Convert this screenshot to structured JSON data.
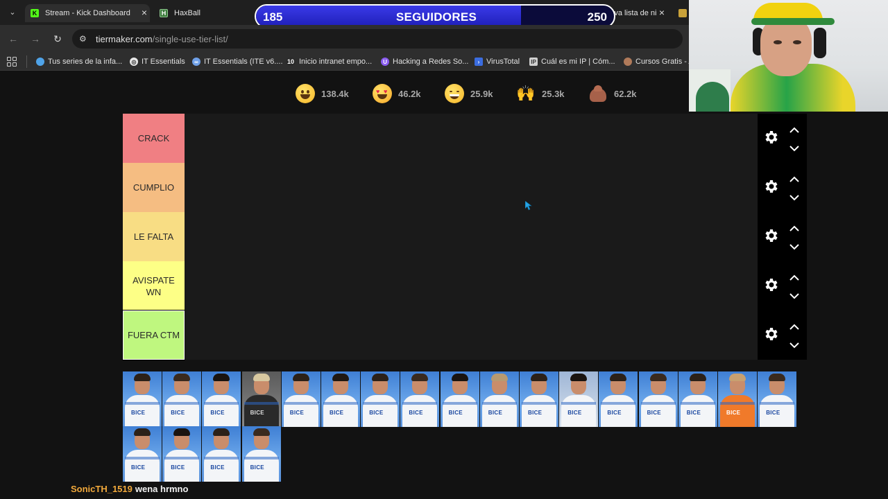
{
  "browser": {
    "tabs": [
      {
        "title": "Stream - Kick Dashboard",
        "favicon": "kick-icon",
        "color": "#53fc18"
      },
      {
        "title": "HaxBall",
        "favicon": "haxball-icon",
        "color": "#3c7a3c"
      },
      {
        "title": "Crear una nueva lista de ni",
        "favicon": "tiermaker-icon",
        "color": "#c9a23a"
      }
    ],
    "address": {
      "domain": "tiermaker.com",
      "path": "/single-use-tier-list/"
    },
    "bookmarks": [
      {
        "label": "Tus series de la infa...",
        "icon": "bookmark-dot-icon",
        "color": "#4fa3e8"
      },
      {
        "label": "IT Essentials",
        "icon": "chrome-icon",
        "color": "#e8e8e8"
      },
      {
        "label": "IT Essentials (ITE v6....",
        "icon": "link-icon",
        "color": "#6fa0e8"
      },
      {
        "label": "Inicio intranet empo...",
        "icon": "ten-icon",
        "color": "#2a2a2a"
      },
      {
        "label": "Hacking a Redes So...",
        "icon": "shield-icon",
        "color": "#8a5cf0"
      },
      {
        "label": "VirusTotal",
        "icon": "virustotal-icon",
        "color": "#3b6de0"
      },
      {
        "label": "Cuál es mi IP | Cóm...",
        "icon": "ip-icon",
        "color": "#cfcfcf"
      },
      {
        "label": "Cursos Gratis - A",
        "icon": "person-icon",
        "color": "#b07a5a"
      }
    ]
  },
  "overlay": {
    "followers_current": "185",
    "followers_label": "SEGUIDORES",
    "followers_goal": "250",
    "progress_fraction": 0.74
  },
  "reactions": [
    {
      "emoji": "grinning-face-icon",
      "count": "138.4k"
    },
    {
      "emoji": "heart-eyes-icon",
      "count": "46.2k"
    },
    {
      "emoji": "laughing-face-icon",
      "count": "25.9k"
    },
    {
      "emoji": "raised-hands-icon",
      "count": "25.3k"
    },
    {
      "emoji": "poop-icon",
      "count": "62.2k"
    }
  ],
  "tiers": [
    {
      "label": "CRACK",
      "color": "#f07f83"
    },
    {
      "label": "CUMPLIO",
      "color": "#f5bd82"
    },
    {
      "label": "LE FALTA",
      "color": "#f8dd84"
    },
    {
      "label": "AVISPATE WN",
      "color": "#fdff86"
    },
    {
      "label": "FUERA CTM",
      "color": "#bff77f"
    }
  ],
  "player_pool": {
    "sponsor_text": "BICE",
    "count": 21
  },
  "chat": {
    "user": "SonicTH_1519",
    "message": "wena hrmno"
  }
}
